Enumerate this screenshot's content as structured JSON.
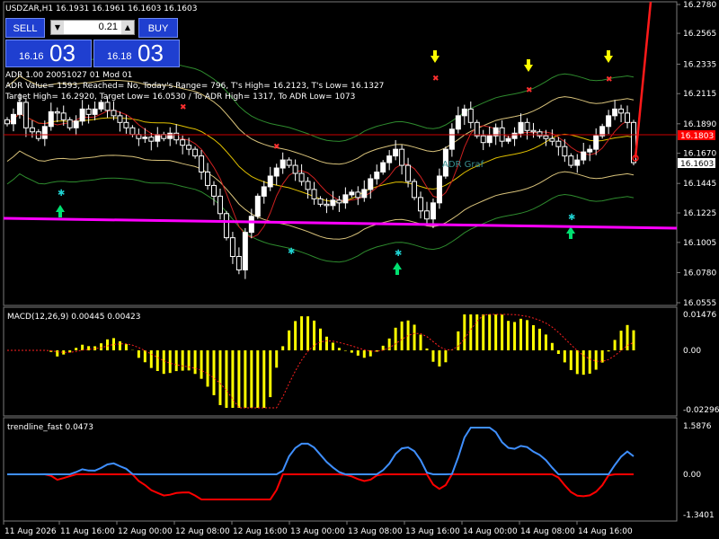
{
  "header": {
    "symbol_line": "USDZAR,H1  16.1931 16.1961 16.1603 16.1603"
  },
  "trade_panel": {
    "sell_label": "SELL",
    "buy_label": "BUY",
    "lot_value": "0.21",
    "sell_price_small": "16.16",
    "sell_price_big": "03",
    "buy_price_small": "16.18",
    "buy_price_big": "03"
  },
  "adr_info": {
    "line1": "ADR 1.00 20051027 01 Mod 01",
    "line2": "ADR Value= 1593, Reached= No, Today's Range= 796, T's High= 16.2123, T's Low= 16.1327",
    "line3": "Target High= 16.2920, Target Low= 16.0530 / To ADR High= 1317, To ADR Low= 1073"
  },
  "adr_label": "ADR Graf",
  "price_axis": {
    "ticks": [
      "16.2780",
      "16.2565",
      "16.2335",
      "16.2115",
      "16.1890",
      "16.1670",
      "16.1445",
      "16.1225",
      "16.1005",
      "16.0780",
      "16.0555"
    ],
    "current_price": "16.1603",
    "red_line_price": "16.1803"
  },
  "macd": {
    "title": "MACD(12,26,9) 0.00445 0.00423",
    "ticks": [
      "0.01476",
      "0.00",
      "-0.02296"
    ]
  },
  "trendline": {
    "title": "trendline_fast 0.0473",
    "ticks": [
      "1.5876",
      "0.00",
      "-1.3401"
    ]
  },
  "time_axis": {
    "labels": [
      "11 Aug 2026",
      "11 Aug 16:00",
      "12 Aug 00:00",
      "12 Aug 08:00",
      "12 Aug 16:00",
      "13 Aug 00:00",
      "13 Aug 08:00",
      "13 Aug 16:00",
      "14 Aug 00:00",
      "14 Aug 08:00",
      "14 Aug 16:00"
    ]
  },
  "colors": {
    "background": "#000000",
    "bull_candle": "#ffffff",
    "bear_candle": "#ffffff",
    "macd_hist": "#ffff00",
    "macd_signal": "#ff0000",
    "trend_up": "#3f8fff",
    "trend_down": "#ff0000",
    "magenta_line": "#ff00ff",
    "price_label_red": "#ff0000",
    "button_blue": "#1f3fd0"
  },
  "chart_data": {
    "type": "candlestick",
    "series_close": [
      16.189,
      16.196,
      16.205,
      16.186,
      16.183,
      16.178,
      16.187,
      16.198,
      16.197,
      16.192,
      16.186,
      16.191,
      16.2,
      16.196,
      16.2,
      16.205,
      16.199,
      16.195,
      16.19,
      16.186,
      16.181,
      16.178,
      16.179,
      16.176,
      16.181,
      16.178,
      16.182,
      16.177,
      16.173,
      16.17,
      16.165,
      16.153,
      16.143,
      16.135,
      16.122,
      16.104,
      16.09,
      16.08,
      16.108,
      16.12,
      16.135,
      16.142,
      16.15,
      16.156,
      16.162,
      16.158,
      16.152,
      16.146,
      16.14,
      16.133,
      16.129,
      16.128,
      16.132,
      16.13,
      16.136,
      16.138,
      16.134,
      16.14,
      16.148,
      16.153,
      16.16,
      16.165,
      16.17,
      16.158,
      16.146,
      16.134,
      16.124,
      16.118,
      16.13,
      16.15,
      16.17,
      16.185,
      16.195,
      16.2,
      16.19,
      16.18,
      16.175,
      16.18,
      16.186,
      16.176,
      16.178,
      16.182,
      16.19,
      16.184,
      16.183,
      16.18,
      16.178,
      16.176,
      16.172,
      16.165,
      16.158,
      16.162,
      16.168,
      16.17,
      16.18,
      16.187,
      16.195,
      16.2,
      16.197,
      16.19,
      16.16
    ]
  }
}
